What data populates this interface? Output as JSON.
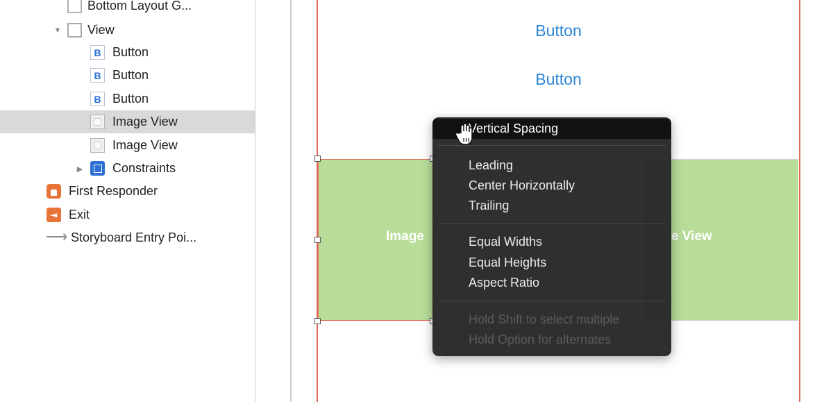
{
  "outline": {
    "items": [
      {
        "label": "Bottom Layout G...",
        "icon": "layout-guide-icon"
      },
      {
        "label": "View",
        "icon": "view-icon",
        "disclosure": "expanded"
      },
      {
        "label": "Button",
        "icon": "button-icon",
        "icon_text": "B"
      },
      {
        "label": "Button",
        "icon": "button-icon",
        "icon_text": "B"
      },
      {
        "label": "Button",
        "icon": "button-icon",
        "icon_text": "B"
      },
      {
        "label": "Image View",
        "icon": "image-view-icon",
        "selected": true
      },
      {
        "label": "Image View",
        "icon": "image-view-icon"
      },
      {
        "label": "Constraints",
        "icon": "constraints-icon",
        "disclosure": "collapsed"
      },
      {
        "label": "First Responder",
        "icon": "first-responder-icon"
      },
      {
        "label": "Exit",
        "icon": "exit-icon"
      },
      {
        "label": "Storyboard Entry Poi...",
        "icon": "arrow-icon"
      }
    ]
  },
  "canvas": {
    "buttons": [
      {
        "label": "Button"
      },
      {
        "label": "Button"
      }
    ],
    "image_views": [
      {
        "label": "Image"
      },
      {
        "label": "e View"
      }
    ]
  },
  "menu": {
    "highlighted": "Vertical Spacing",
    "group1": [
      "Leading",
      "Center Horizontally",
      "Trailing"
    ],
    "group2": [
      "Equal Widths",
      "Equal Heights",
      "Aspect Ratio"
    ],
    "hints": [
      "Hold Shift to select multiple",
      "Hold Option for alternates"
    ]
  },
  "colors": {
    "accent": "#2b86d6",
    "constraint_red": "#e0685a",
    "image_green": "#b7dd98",
    "menu_bg": "#262626",
    "selection": "#d9d9d9"
  }
}
